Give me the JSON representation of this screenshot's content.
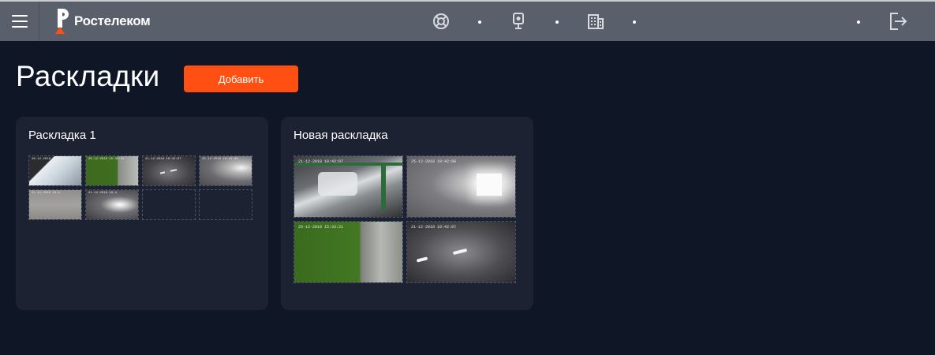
{
  "header": {
    "brand": "Ростелеком",
    "icons": [
      "menu-icon",
      "support-icon",
      "camera-icon",
      "building-icon",
      "logout-icon"
    ]
  },
  "page": {
    "title": "Раскладки",
    "add_button": "Добавить"
  },
  "layouts": [
    {
      "name": "Раскладка 1",
      "grid": "4x4",
      "cells": [
        {
          "timestamp": "26-12-2018 10:42:08",
          "scene": "window"
        },
        {
          "timestamp": "25-12-2018 15:33:21",
          "scene": "green"
        },
        {
          "timestamp": "21-12-2018 10:42:07",
          "scene": "floor-lights"
        },
        {
          "timestamp": "25-12-2018 10:42:08",
          "scene": "wall-light"
        },
        {
          "timestamp": "21-12-2018 10:4",
          "scene": "gray"
        },
        {
          "timestamp": "21-12-2018 10:4",
          "scene": "bright-light"
        },
        {
          "timestamp": "",
          "scene": "empty"
        },
        {
          "timestamp": "",
          "scene": "empty"
        }
      ]
    },
    {
      "name": "Новая раскладка",
      "grid": "2x2",
      "cells": [
        {
          "timestamp": "21-12-2018 10:42:07",
          "scene": "machinery"
        },
        {
          "timestamp": "25-12-2018 10:42:08",
          "scene": "wall-light"
        },
        {
          "timestamp": "25-12-2018 15:33:21",
          "scene": "green"
        },
        {
          "timestamp": "21-12-2018 10:42:07",
          "scene": "floor-lights"
        }
      ]
    }
  ],
  "colors": {
    "background": "#0f1726",
    "topbar": "#5a606b",
    "card": "#1c2232",
    "accent": "#ff4f12"
  }
}
